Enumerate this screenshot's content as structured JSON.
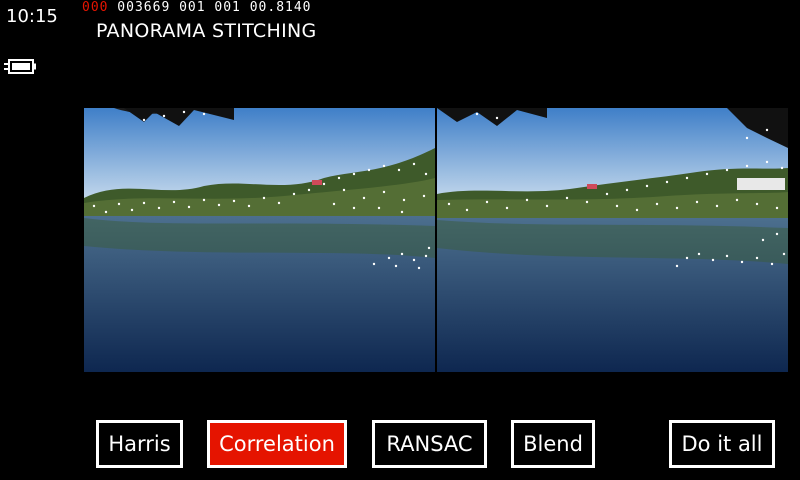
{
  "status": {
    "time": "10:15",
    "battery_icon": "battery-charging-icon"
  },
  "debug": {
    "red_prefix": "000",
    "rest": " 003669 001 001 00.8140"
  },
  "page": {
    "title": "PANORAMA STITCHING"
  },
  "images": [
    {
      "name": "left-lake-photo",
      "icon": "photo"
    },
    {
      "name": "right-lake-photo",
      "icon": "photo"
    }
  ],
  "buttons": [
    {
      "label": "Harris",
      "active": false
    },
    {
      "label": "Correlation",
      "active": true
    },
    {
      "label": "RANSAC",
      "active": false
    },
    {
      "label": "Blend",
      "active": false
    },
    {
      "label": "Do it all",
      "active": false
    }
  ],
  "colors": {
    "accent": "#e51400",
    "background": "#000000",
    "foreground": "#ffffff"
  }
}
